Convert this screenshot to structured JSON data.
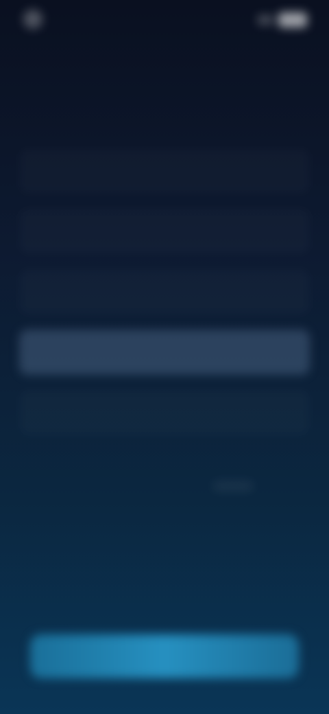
{
  "status_bar": {
    "time": "",
    "icons": [
      "signal-icon",
      "battery-icon"
    ]
  },
  "question": {
    "line1": "",
    "line2": ""
  },
  "options": [
    {
      "label": "",
      "selected": false
    },
    {
      "label": "",
      "selected": false
    },
    {
      "label": "",
      "selected": false
    },
    {
      "label": "",
      "selected": true
    },
    {
      "label": "",
      "selected": false
    }
  ],
  "footer": {
    "label": "",
    "button_label": ""
  },
  "colors": {
    "background_top": "#0a1020",
    "background_bottom": "#0a3556",
    "accent_button": "#2690c0",
    "selected_option": "#4e6a8a"
  }
}
